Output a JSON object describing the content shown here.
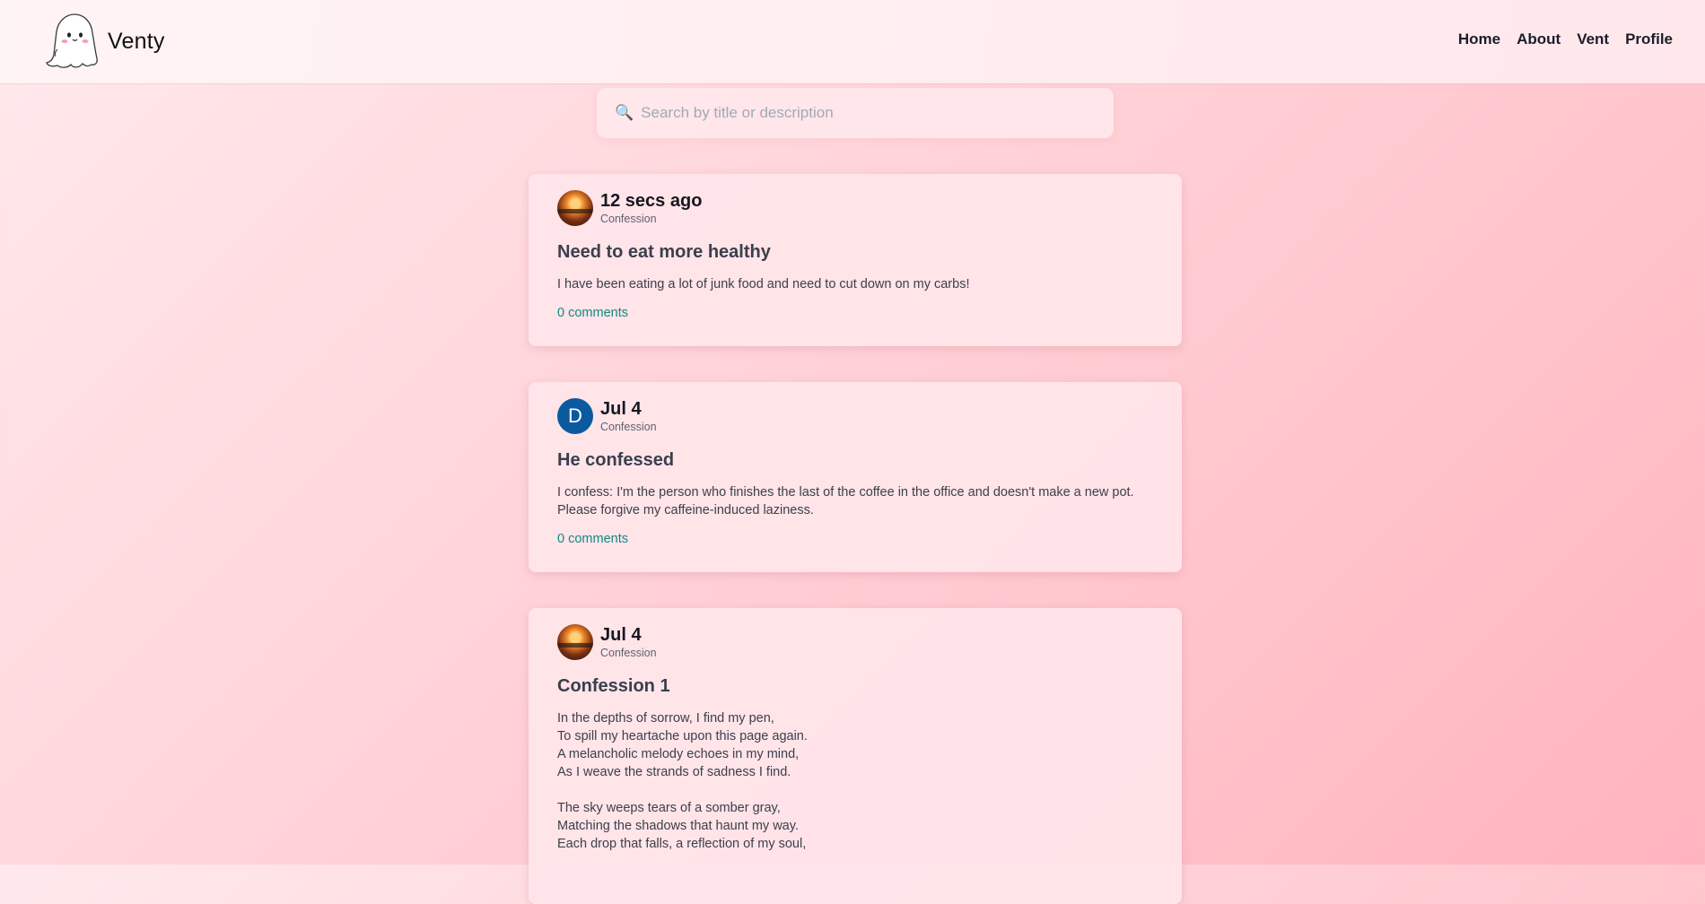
{
  "app": {
    "name": "Venty"
  },
  "nav": {
    "links": [
      "Home",
      "About",
      "Vent",
      "Profile"
    ]
  },
  "search": {
    "placeholder": "Search by title or description",
    "value": ""
  },
  "posts": [
    {
      "time": "12 secs ago",
      "category": "Confession",
      "avatar": {
        "type": "photo"
      },
      "title": "Need to eat more healthy",
      "body": "I have been eating a lot of junk food and need to cut down on my carbs!",
      "comments": "0 comments"
    },
    {
      "time": "Jul 4",
      "category": "Confession",
      "avatar": {
        "type": "letter",
        "letter": "D",
        "color": "#0b5aa0"
      },
      "title": "He confessed",
      "body": "I confess: I'm the person who finishes the last of the coffee in the office and doesn't make a new pot. Please forgive my caffeine-induced laziness.",
      "comments": "0 comments"
    },
    {
      "time": "Jul 4",
      "category": "Confession",
      "avatar": {
        "type": "photo"
      },
      "title": "Confession 1",
      "body": "In the depths of sorrow, I find my pen,\nTo spill my heartache upon this page again.\nA melancholic melody echoes in my mind,\nAs I weave the strands of sadness I find.\n\nThe sky weeps tears of a somber gray,\nMatching the shadows that haunt my way.\nEach drop that falls, a reflection of my soul,"
    }
  ],
  "colors": {
    "accent": "#0e8a80",
    "background": "#ffd2d8",
    "avatar_letter_bg": "#0b5aa0"
  },
  "icons": {
    "logo": "ghost-logo-icon",
    "search": "search-icon"
  }
}
